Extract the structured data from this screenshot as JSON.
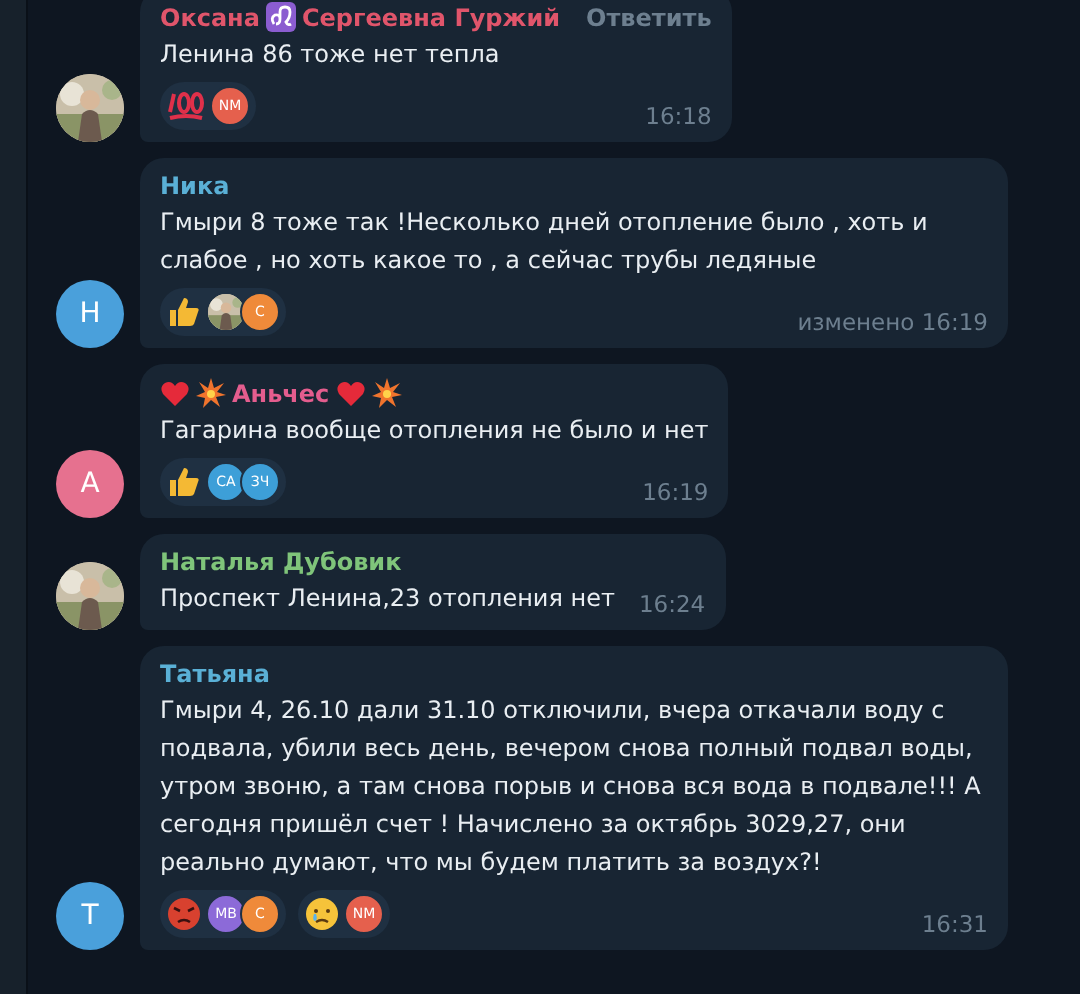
{
  "messages": [
    {
      "author": [
        {
          "kind": "text",
          "text": "Оксана"
        },
        {
          "kind": "leo"
        },
        {
          "kind": "text",
          "text": "Сергеевна Гуржий"
        }
      ],
      "color": "#e0556b",
      "reply_label": "Ответить",
      "avatar": {
        "kind": "picture"
      },
      "text": "Ленина 86 тоже нет тепла",
      "reactions": [
        {
          "kind": "hundred",
          "avatars": [
            {
              "kind": "initials",
              "initials": "NM",
              "color": "#e5604d"
            }
          ]
        }
      ],
      "time": "16:18"
    },
    {
      "author": [
        {
          "kind": "text",
          "text": "Ника"
        }
      ],
      "color": "#5ab0d6",
      "avatar": {
        "kind": "initials",
        "letter": "Н",
        "color": "#4aa0db"
      },
      "text": "Гмыри 8 тоже так !Несколько дней отопление было , хоть и слабое , но хоть какое то , а сейчас трубы ледяные",
      "reactions": [
        {
          "kind": "thumbs_up",
          "avatars": [
            {
              "kind": "picture"
            },
            {
              "kind": "initials",
              "initials": "С",
              "color": "#ef8a3a"
            }
          ]
        }
      ],
      "time": "изменено 16:19"
    },
    {
      "author": [
        {
          "kind": "heart"
        },
        {
          "kind": "burst"
        },
        {
          "kind": "text",
          "text": "Аньчес"
        },
        {
          "kind": "heart"
        },
        {
          "kind": "burst"
        }
      ],
      "color": "#e45d8e",
      "avatar": {
        "kind": "initials",
        "letter": "А",
        "color": "#e6718f"
      },
      "text": "Гагарина вообще отопления не было и нет",
      "reactions": [
        {
          "kind": "thumbs_up",
          "avatars": [
            {
              "kind": "initials",
              "initials": "CA",
              "color": "#3d9fd8"
            },
            {
              "kind": "initials",
              "initials": "ЗЧ",
              "color": "#3d9fd8"
            }
          ]
        }
      ],
      "time": "16:19"
    },
    {
      "author": [
        {
          "kind": "text",
          "text": "Наталья Дубовик"
        }
      ],
      "color": "#7fc47a",
      "avatar": {
        "kind": "picture"
      },
      "text": "Проспект Ленина,23  отопления нет",
      "time": "16:24"
    },
    {
      "author": [
        {
          "kind": "text",
          "text": "Татьяна"
        }
      ],
      "color": "#5ab0d6",
      "avatar": {
        "kind": "initials",
        "letter": "Т",
        "color": "#4aa0db"
      },
      "text": "Гмыри 4, 26.10 дали 31.10 отключили, вчера откачали воду с подвала, убили весь день, вечером снова полный подвал воды, утром звоню, а там снова порыв и снова вся вода в подвале!!! А сегодня пришёл счет ! Начислено за октябрь 3029,27, они реально думают, что мы будем платить за воздух?!",
      "reactions": [
        {
          "kind": "angry",
          "avatars": [
            {
              "kind": "initials",
              "initials": "MB",
              "color": "#8c6ad8"
            },
            {
              "kind": "initials",
              "initials": "С",
              "color": "#ef8a3a"
            }
          ]
        },
        {
          "kind": "crying",
          "avatars": [
            {
              "kind": "initials",
              "initials": "NM",
              "color": "#e5604d"
            }
          ]
        }
      ],
      "time": "16:31"
    }
  ]
}
